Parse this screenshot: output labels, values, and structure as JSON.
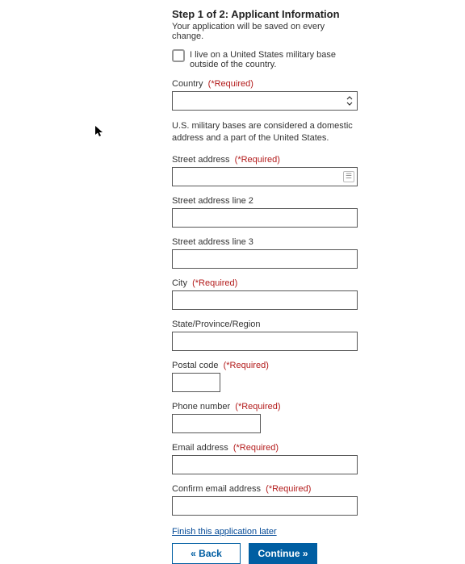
{
  "step": {
    "title": "Step 1 of 2: Applicant Information",
    "subtitle": "Your application will be saved on every change."
  },
  "military_checkbox": {
    "label": "I live on a United States military base outside of the country."
  },
  "required_marker": "(*Required)",
  "fields": {
    "country": {
      "label": "Country"
    },
    "country_helper": "U.S. military bases are considered a domestic address and a part of the United States.",
    "street1": {
      "label": "Street address"
    },
    "street2": {
      "label": "Street address line 2"
    },
    "street3": {
      "label": "Street address line 3"
    },
    "city": {
      "label": "City"
    },
    "state": {
      "label": "State/Province/Region"
    },
    "postal": {
      "label": "Postal code"
    },
    "phone": {
      "label": "Phone number"
    },
    "email": {
      "label": "Email address"
    },
    "confirm_email": {
      "label": "Confirm email address"
    }
  },
  "finish_link": "Finish this application later",
  "buttons": {
    "back": "« Back",
    "continue": "Continue »"
  }
}
